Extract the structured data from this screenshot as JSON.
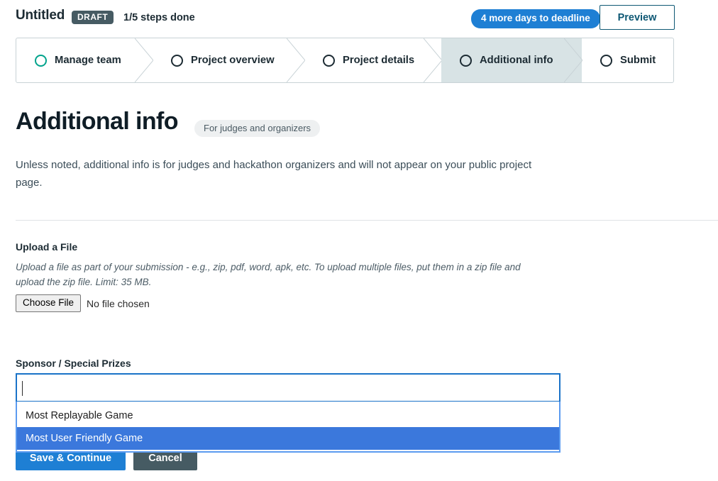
{
  "header": {
    "project_title": "Untitled",
    "status_badge": "DRAFT",
    "steps_progress": "1/5 steps done",
    "deadline_badge": "4 more days to deadline",
    "preview_button": "Preview",
    "accent_blue": "#1e7fd4",
    "badge_slate": "#465b63",
    "preview_border": "#0e5874"
  },
  "stepper": {
    "active_background": "#d8e3e5",
    "done_circle_color": "#00a38c",
    "steps": [
      {
        "label": "Manage team",
        "state": "done",
        "icon": "circle-outline-icon"
      },
      {
        "label": "Project overview",
        "state": "todo",
        "icon": "circle-outline-icon"
      },
      {
        "label": "Project details",
        "state": "todo",
        "icon": "circle-outline-icon"
      },
      {
        "label": "Additional info",
        "state": "active",
        "icon": "circle-outline-icon"
      },
      {
        "label": "Submit",
        "state": "todo",
        "icon": "circle-outline-icon"
      }
    ]
  },
  "page": {
    "title": "Additional info",
    "title_pill": "For judges and organizers",
    "intro": "Unless noted, additional info is for judges and hackathon organizers and will not appear on your public project page."
  },
  "upload": {
    "label": "Upload a File",
    "help": "Upload a file as part of your submission - e.g., zip, pdf, word, apk, etc. To upload multiple files, put them in a zip file and upload the zip file. Limit: 35 MB.",
    "choose_file_button": "Choose File",
    "file_status": "No file chosen"
  },
  "sponsor": {
    "label": "Sponsor / Special Prizes",
    "input_value": "",
    "focus_border_color": "#1a73c8",
    "dropdown_border_color": "#5b9bf0",
    "highlight_color": "#3b78dc",
    "options": [
      {
        "label": "Most Replayable Game",
        "selected": false
      },
      {
        "label": "Most User Friendly Game",
        "selected": true
      }
    ]
  },
  "form_actions": {
    "save_label": "Save & Continue",
    "cancel_label": "Cancel"
  }
}
